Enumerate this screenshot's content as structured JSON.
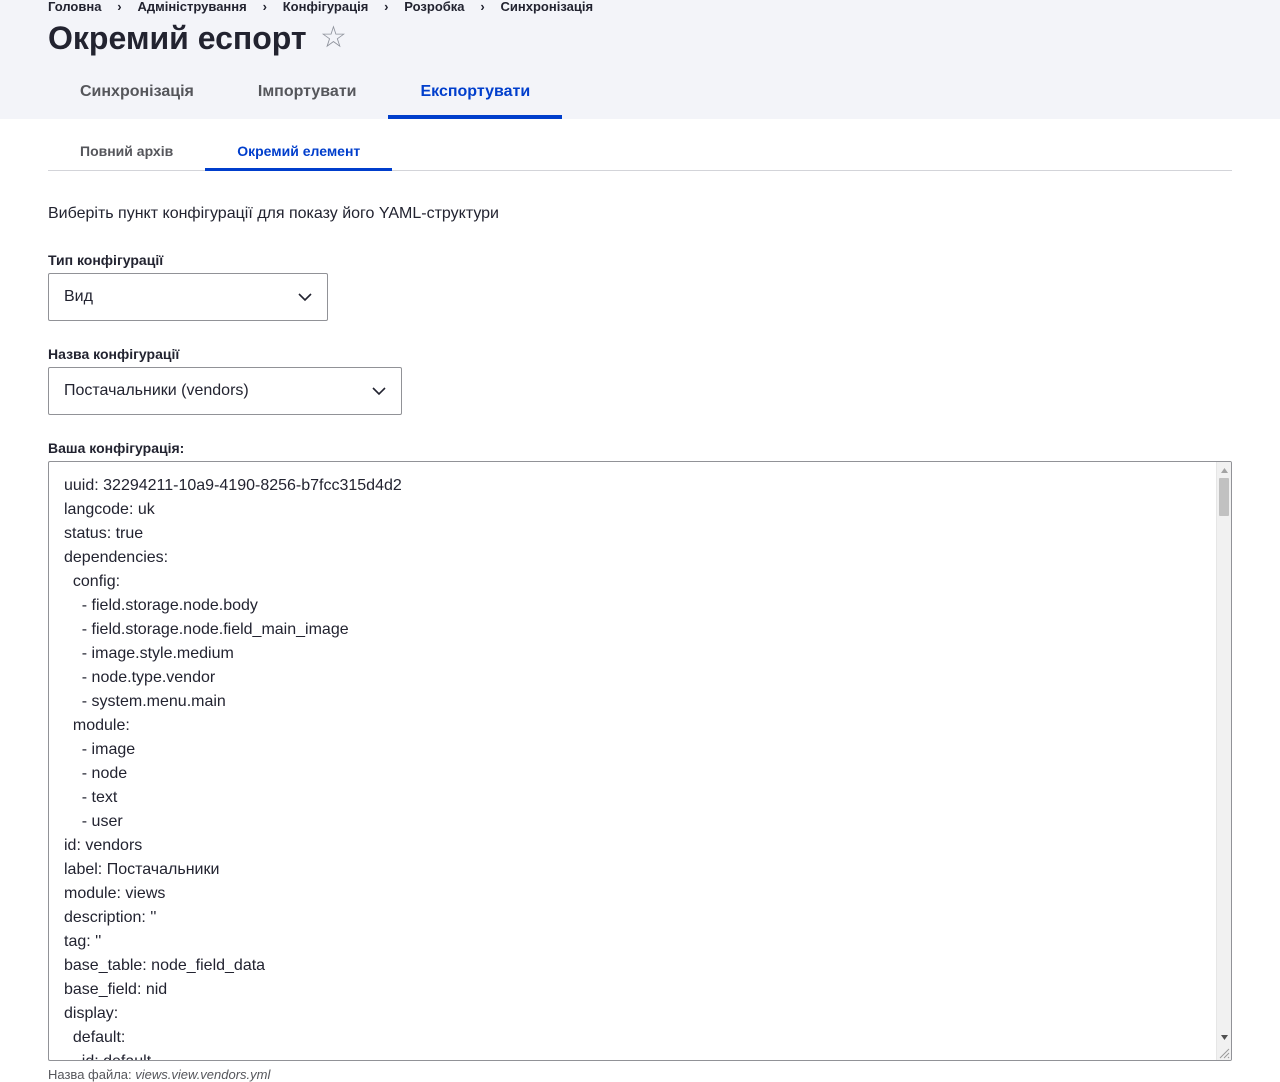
{
  "breadcrumb": [
    "Головна",
    "Адміністрування",
    "Конфігурація",
    "Розробка",
    "Синхронізація"
  ],
  "page": {
    "title": "Окремий еспорт",
    "star_icon": "star-outline-icon"
  },
  "primary_tabs": [
    {
      "label": "Синхронізація",
      "active": false
    },
    {
      "label": "Імпортувати",
      "active": false
    },
    {
      "label": "Експортувати",
      "active": true
    }
  ],
  "secondary_tabs": [
    {
      "label": "Повний архів",
      "active": false
    },
    {
      "label": "Окремий елемент",
      "active": true
    }
  ],
  "description": "Виберіть пункт конфігурації для показу його YAML-структури",
  "config_type": {
    "label": "Тип конфігурації",
    "value": "Вид"
  },
  "config_name": {
    "label": "Назва конфігурації",
    "value": "Постачальники (vendors)"
  },
  "config_output": {
    "label": "Ваша конфігурація:",
    "lines": [
      "uuid: 32294211-10a9-4190-8256-b7fcc315d4d2",
      "langcode: uk",
      "status: true",
      "dependencies:",
      "  config:",
      "    - field.storage.node.body",
      "    - field.storage.node.field_main_image",
      "    - image.style.medium",
      "    - node.type.vendor",
      "    - system.menu.main",
      "  module:",
      "    - image",
      "    - node",
      "    - text",
      "    - user",
      "id: vendors",
      "label: Постачальники",
      "module: views",
      "description: ''",
      "tag: ''",
      "base_table: node_field_data",
      "base_field: nid",
      "display:",
      "  default:",
      "    id: default"
    ]
  },
  "filename": {
    "label": "Назва файла:",
    "value": "views.view.vendors.yml"
  },
  "colors": {
    "accent": "#003ecc",
    "header_bg": "#f3f4f9",
    "text": "#222330"
  }
}
